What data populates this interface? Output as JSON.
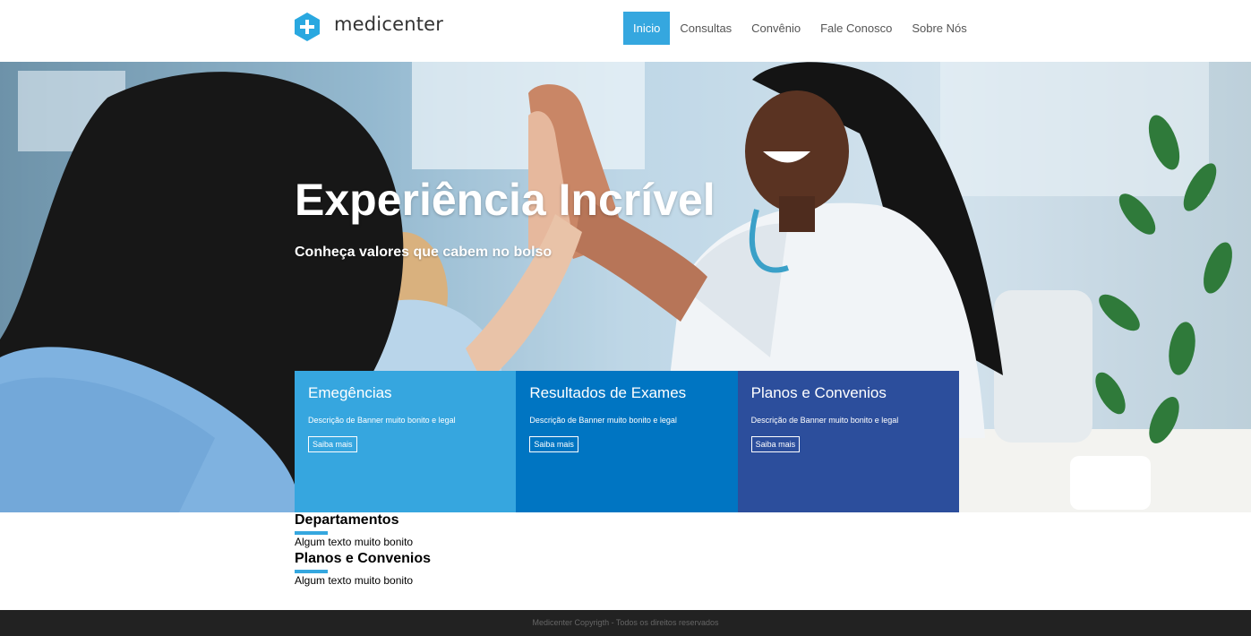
{
  "header": {
    "logo_text": "medicenter",
    "nav": [
      {
        "label": "Inicio",
        "active": true
      },
      {
        "label": "Consultas",
        "active": false
      },
      {
        "label": "Convênio",
        "active": false
      },
      {
        "label": "Fale Conosco",
        "active": false
      },
      {
        "label": "Sobre Nós",
        "active": false
      }
    ]
  },
  "hero": {
    "title": "Experiência Incrível",
    "subtitle": "Conheça valores que cabem no bolso"
  },
  "cards": [
    {
      "title": "Emegências",
      "description": "Descrição de Banner muito bonito e legal",
      "button": "Saiba mais",
      "color": "#36a6df"
    },
    {
      "title": "Resultados de Exames",
      "description": "Descrição de Banner muito bonito e legal",
      "button": "Saiba mais",
      "color": "#0075c2"
    },
    {
      "title": "Planos e Convenios",
      "description": "Descrição de Banner muito bonito e legal",
      "button": "Saiba mais",
      "color": "#2c4e9c"
    }
  ],
  "sections": [
    {
      "title": "Departamentos",
      "text": "Algum texto muito bonito"
    },
    {
      "title": "Planos e Convenios",
      "text": "Algum texto muito bonito"
    }
  ],
  "footer": {
    "text": "Medicenter Copyrigth - Todos os direitos reservados"
  },
  "colors": {
    "accent": "#35a7df",
    "footer_bg": "#222222"
  }
}
